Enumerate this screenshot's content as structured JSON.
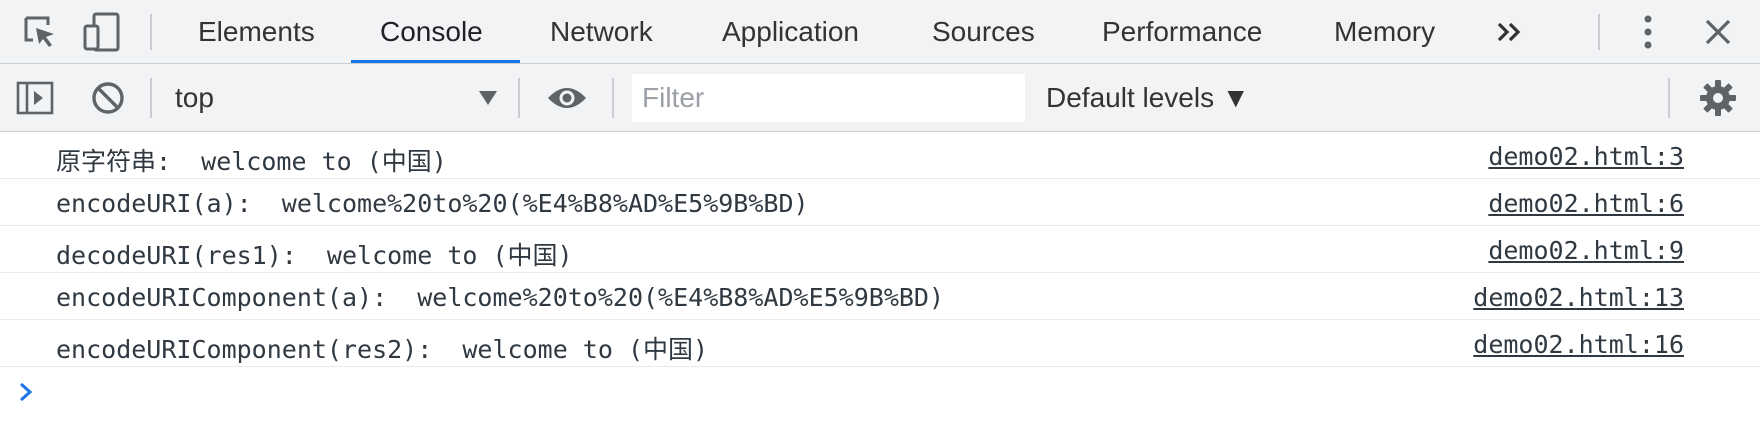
{
  "tabs": [
    {
      "label": "Elements",
      "active": false
    },
    {
      "label": "Console",
      "active": true
    },
    {
      "label": "Network",
      "active": false
    },
    {
      "label": "Application",
      "active": false
    },
    {
      "label": "Sources",
      "active": false
    },
    {
      "label": "Performance",
      "active": false
    },
    {
      "label": "Memory",
      "active": false
    }
  ],
  "icons": {
    "inspect": "inspect-element-icon",
    "device": "device-toolbar-icon",
    "more_tabs": "chevron-double-right-icon",
    "kebab": "more-vertical-icon",
    "close": "close-icon",
    "sidebar": "show-sidebar-icon",
    "clear": "clear-console-icon",
    "eye": "live-expression-icon",
    "settings": "gear-icon",
    "prompt": "prompt-chevron-icon"
  },
  "toolbar": {
    "context": "top",
    "filter_placeholder": "Filter",
    "levels": "Default levels ▼"
  },
  "console": {
    "messages": [
      {
        "text": "原字符串:  welcome to (中国)",
        "source": "demo02.html:3"
      },
      {
        "text": "encodeURI(a):  welcome%20to%20(%E4%B8%AD%E5%9B%BD)",
        "source": "demo02.html:6"
      },
      {
        "text": "decodeURI(res1):  welcome to (中国)",
        "source": "demo02.html:9"
      },
      {
        "text": "encodeURIComponent(a):  welcome%20to%20(%E4%B8%AD%E5%9B%BD)",
        "source": "demo02.html:13"
      },
      {
        "text": "encodeURIComponent(res2):  welcome to (中国)",
        "source": "demo02.html:16"
      }
    ]
  },
  "colors": {
    "accent": "#1a73e8",
    "toolbar_bg": "#f1f3f4",
    "icon": "#5f6368"
  }
}
